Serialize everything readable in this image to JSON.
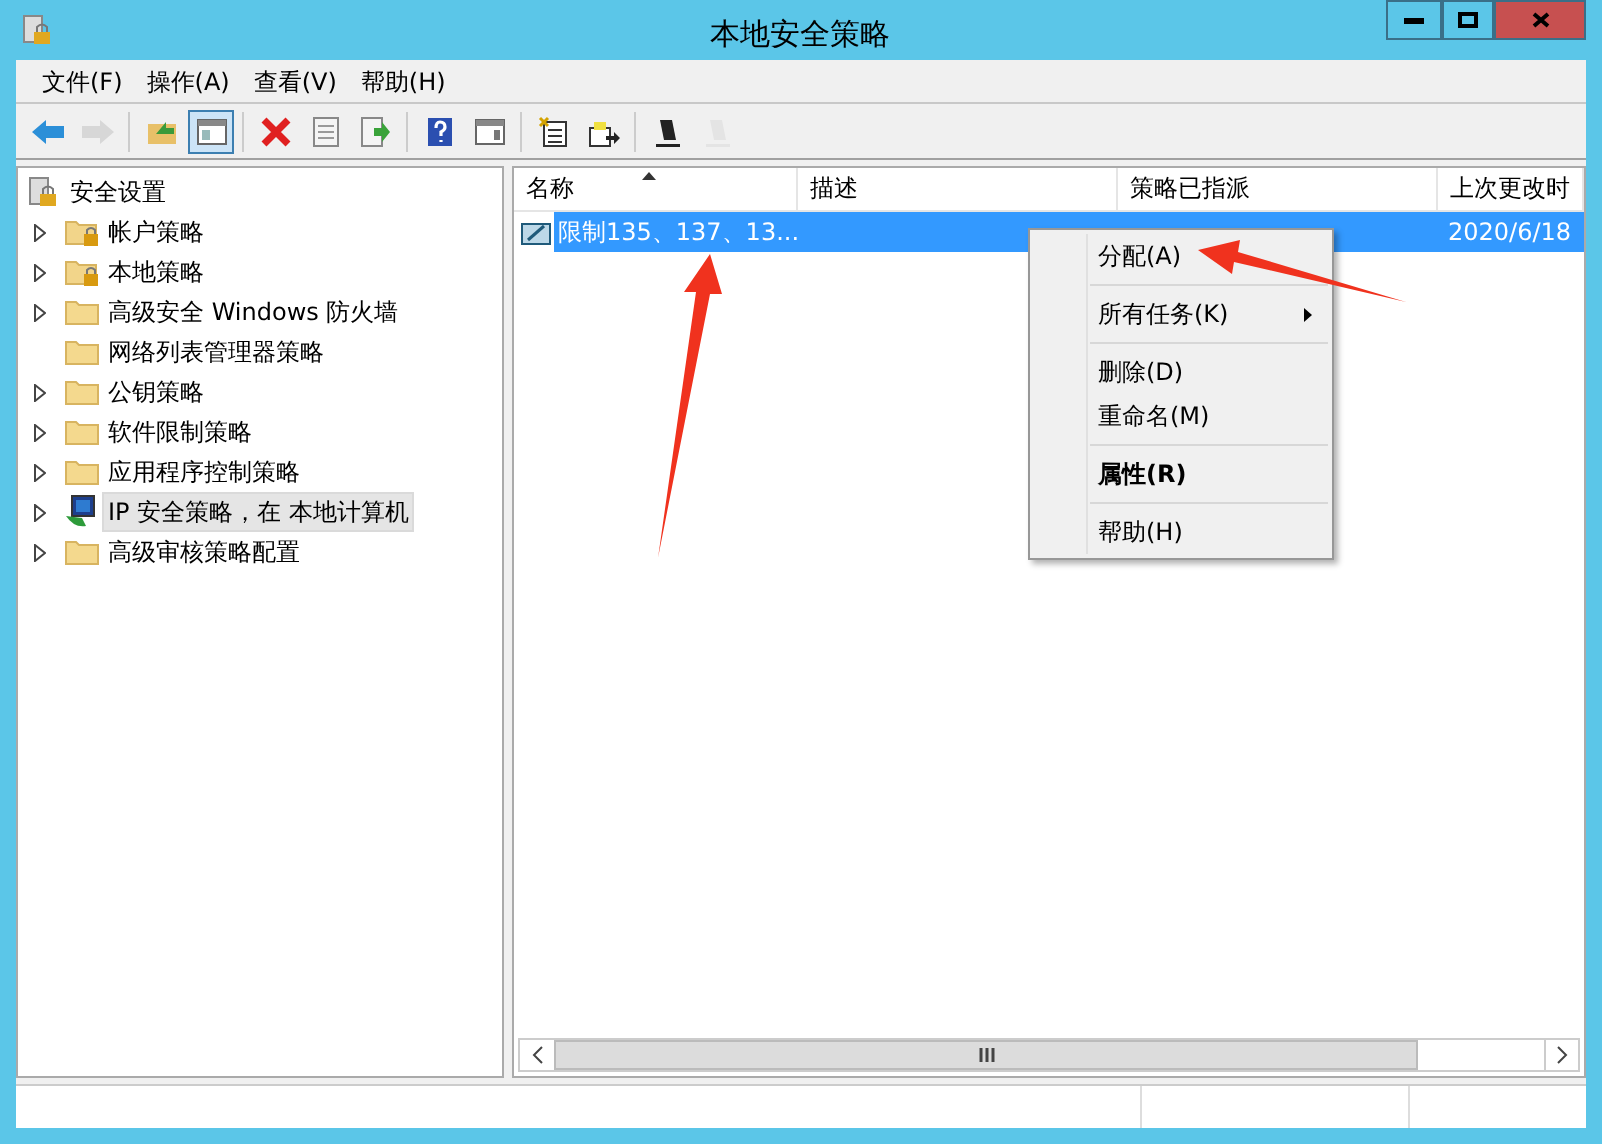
{
  "window": {
    "title": "本地安全策略"
  },
  "menu": [
    "文件(F)",
    "操作(A)",
    "查看(V)",
    "帮助(H)"
  ],
  "toolbar": [
    {
      "kind": "back",
      "pressed": false,
      "disabled": false
    },
    {
      "kind": "forward",
      "pressed": false,
      "disabled": true
    },
    {
      "kind": "separator"
    },
    {
      "kind": "up",
      "pressed": false,
      "disabled": false
    },
    {
      "kind": "tree",
      "pressed": true,
      "disabled": false
    },
    {
      "kind": "separator"
    },
    {
      "kind": "delete",
      "pressed": false,
      "disabled": false
    },
    {
      "kind": "properties",
      "pressed": false,
      "disabled": false
    },
    {
      "kind": "export",
      "pressed": false,
      "disabled": false
    },
    {
      "kind": "separator"
    },
    {
      "kind": "help",
      "pressed": false,
      "disabled": false
    },
    {
      "kind": "panel",
      "pressed": false,
      "disabled": false
    },
    {
      "kind": "separator"
    },
    {
      "kind": "new",
      "pressed": false,
      "disabled": false
    },
    {
      "kind": "assign",
      "pressed": false,
      "disabled": false
    },
    {
      "kind": "separator"
    },
    {
      "kind": "plug",
      "pressed": false,
      "disabled": false
    },
    {
      "kind": "plug",
      "pressed": false,
      "disabled": true
    }
  ],
  "tree": {
    "root": {
      "label": "安全设置"
    },
    "children": [
      {
        "label": "帐户策略",
        "kind": "locked",
        "expandable": true,
        "selected": false
      },
      {
        "label": "本地策略",
        "kind": "locked",
        "expandable": true,
        "selected": false
      },
      {
        "label": "高级安全 Windows 防火墙",
        "kind": "folder",
        "expandable": true,
        "selected": false
      },
      {
        "label": "网络列表管理器策略",
        "kind": "folder",
        "expandable": false,
        "selected": false
      },
      {
        "label": "公钥策略",
        "kind": "folder",
        "expandable": true,
        "selected": false
      },
      {
        "label": "软件限制策略",
        "kind": "folder",
        "expandable": true,
        "selected": false
      },
      {
        "label": "应用程序控制策略",
        "kind": "folder",
        "expandable": true,
        "selected": false
      },
      {
        "label": "IP 安全策略，在 本地计算机",
        "kind": "computer",
        "expandable": true,
        "selected": true
      },
      {
        "label": "高级审核策略配置",
        "kind": "folder",
        "expandable": true,
        "selected": false
      }
    ]
  },
  "table": {
    "columns": [
      {
        "label": "名称",
        "sorted": true
      },
      {
        "label": "描述",
        "sorted": false
      },
      {
        "label": "策略已指派",
        "sorted": false
      },
      {
        "label": "上次更改时",
        "sorted": false
      }
    ],
    "rows": [
      {
        "name": "限制135、137、13...",
        "changed": "2020/6/18",
        "selected": true
      }
    ]
  },
  "context_menu": [
    {
      "kind": "item",
      "label": "分配(A)",
      "default": false,
      "submenu": false
    },
    {
      "kind": "separator"
    },
    {
      "kind": "item",
      "label": "所有任务(K)",
      "default": false,
      "submenu": true
    },
    {
      "kind": "separator"
    },
    {
      "kind": "item",
      "label": "删除(D)",
      "default": false,
      "submenu": false
    },
    {
      "kind": "item",
      "label": "重命名(M)",
      "default": false,
      "submenu": false
    },
    {
      "kind": "separator"
    },
    {
      "kind": "item",
      "label": "属性(R)",
      "default": true,
      "submenu": false
    },
    {
      "kind": "separator"
    },
    {
      "kind": "item",
      "label": "帮助(H)",
      "default": false,
      "submenu": false
    }
  ]
}
